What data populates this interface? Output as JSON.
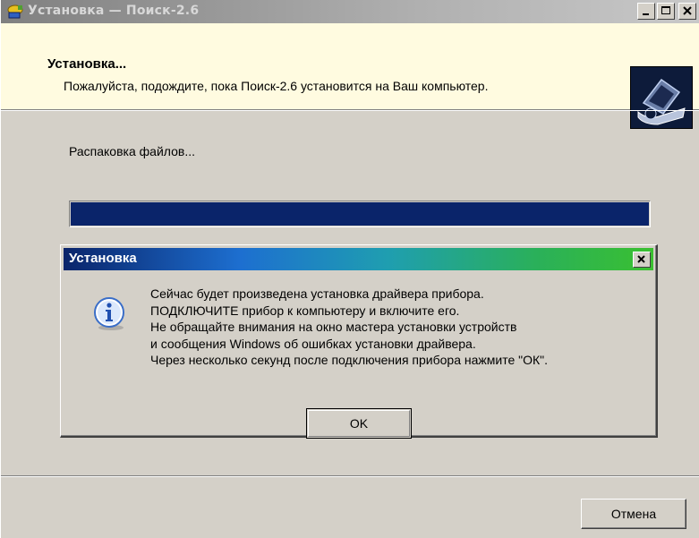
{
  "window": {
    "title": "Установка — Поиск-2.6",
    "icons": {
      "app": "setup-icon",
      "minimize": "minimize-icon",
      "maximize": "maximize-icon",
      "close": "close-icon"
    }
  },
  "header": {
    "title": "Установка...",
    "subtitle": "Пожалуйста, подождите, пока Поиск-2.6 установится на Ваш компьютер.",
    "logo_icon": "computer-install-icon"
  },
  "main": {
    "status": "Распаковка файлов...",
    "progress": 1.0
  },
  "dialog": {
    "title": "Установка",
    "icon": "info-icon",
    "message_lines": [
      "Сейчас будет произведена установка драйвера прибора.",
      "ПОДКЛЮЧИТЕ прибор к компьютеру и включите его.",
      "Не обращайте внимания на окно мастера установки устройств",
      "и сообщения Windows об ошибках установки драйвера.",
      "Через несколько секунд после подключения прибора нажмите \"ОК\"."
    ],
    "ok_label": "OK"
  },
  "footer": {
    "cancel_label": "Отмена"
  },
  "colors": {
    "progress_fill": "#0a246a",
    "header_bg": "#fffbe0",
    "window_bg": "#d4d0c8"
  }
}
